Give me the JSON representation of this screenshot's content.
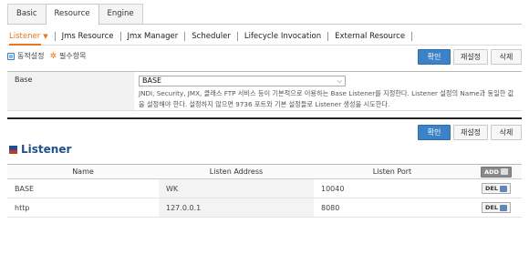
{
  "top_tabs": [
    {
      "label": "Basic",
      "active": false
    },
    {
      "label": "Resource",
      "active": true
    },
    {
      "label": "Engine",
      "active": false
    }
  ],
  "sub_tabs": [
    {
      "label": "Listener",
      "active": true
    },
    {
      "label": "Jms Resource",
      "active": false
    },
    {
      "label": "Jmx Manager",
      "active": false
    },
    {
      "label": "Scheduler",
      "active": false
    },
    {
      "label": "Lifecycle Invocation",
      "active": false
    },
    {
      "label": "External Resource",
      "active": false
    }
  ],
  "options": {
    "dynamic_label": "동적설정",
    "required_label": "필수항목"
  },
  "actions": {
    "confirm": "확인",
    "reset": "재설정",
    "delete": "삭제"
  },
  "form": {
    "label": "Base",
    "select_value": "BASE",
    "desc_line1": "JNDI, Security, JMX, 클래스 FTP 서비스 등이 기본적으로 이용하는 Base Listener를 지정한다. Listener 설정의 Name과 동일한 값",
    "desc_line2": "을 설정해야 한다. 설정하지 않으면 9736 포트와 기본 설정들로 Listener 생성을 시도한다."
  },
  "section": {
    "title": "Listener"
  },
  "table": {
    "headers": [
      "Name",
      "Listen Address",
      "Listen Port"
    ],
    "add_label": "ADD",
    "del_label": "DEL",
    "rows": [
      {
        "name": "BASE",
        "address": "WK",
        "port": "10040"
      },
      {
        "name": "http",
        "address": "127.0.0.1",
        "port": "8080"
      }
    ]
  },
  "colors": {
    "accent": "#e8751a",
    "primary": "#3b82c7",
    "title": "#1f4f8f"
  }
}
